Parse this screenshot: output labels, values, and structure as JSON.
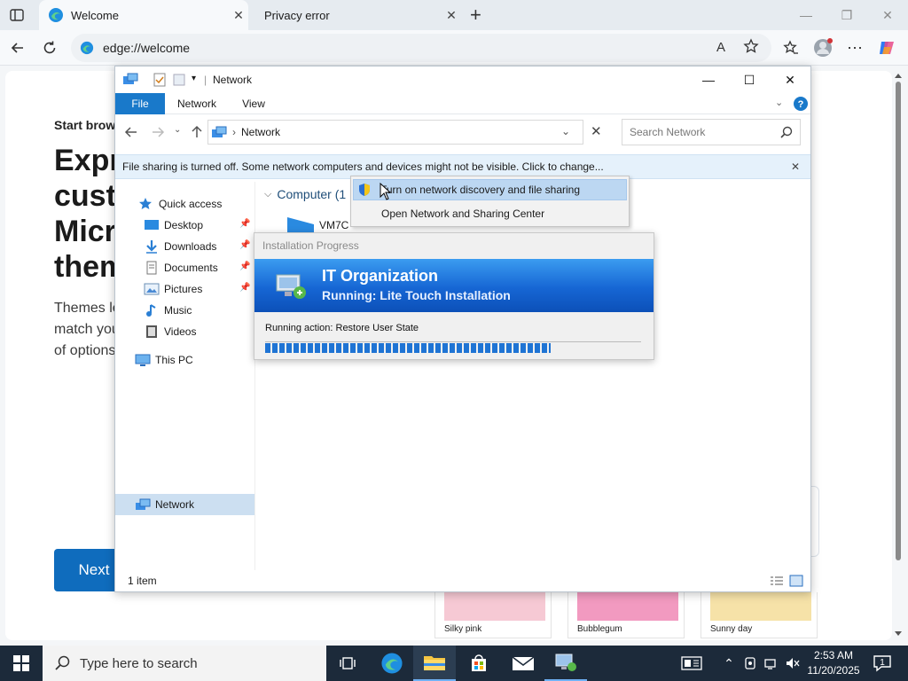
{
  "browser": {
    "tabs": [
      {
        "title": "Welcome",
        "active": true
      },
      {
        "title": "Privacy error",
        "active": false
      }
    ],
    "address": "edge://welcome",
    "new_tab_symbol": "+",
    "close_symbol": "✕"
  },
  "welcome": {
    "start_label": "Start brows",
    "hero_lines": [
      "Expre",
      "custo",
      "Micro",
      "them"
    ],
    "body_lines": [
      "Themes le",
      "match you",
      "of options"
    ],
    "next_button": "Next",
    "themes": [
      {
        "label": "Silky pink",
        "color": "#f6c9d4"
      },
      {
        "label": "Bubblegum",
        "color": "#f29ac0"
      },
      {
        "label": "Sunny day",
        "color": "#f6e2a8"
      }
    ]
  },
  "explorer": {
    "title": "Network",
    "ribbon_tabs": [
      "File",
      "Network",
      "View"
    ],
    "path": "Network",
    "search_placeholder": "Search Network",
    "info_bar": "File sharing is turned off. Some network computers and devices might not be visible. Click to change...",
    "nav": {
      "quick_access": "Quick access",
      "pinned": [
        "Desktop",
        "Downloads",
        "Documents",
        "Pictures"
      ],
      "unpinned": [
        "Music",
        "Videos"
      ],
      "this_pc": "This PC",
      "network": "Network"
    },
    "group_header": "Computer (1",
    "item_name": "VM7C",
    "status": "1 item"
  },
  "context_menu": {
    "items": [
      "Turn on network discovery and file sharing",
      "Open Network and Sharing Center"
    ]
  },
  "installation": {
    "window_title": "Installation Progress",
    "org": "IT Organization",
    "running": "Running: Lite Touch Installation",
    "action": "Running action: Restore User State",
    "progress_fraction": 0.76,
    "accent": "#1666d4"
  },
  "taskbar": {
    "search_placeholder": "Type here to search",
    "time": "2:53 AM",
    "date": "11/20/2025",
    "notification_count": "1"
  }
}
